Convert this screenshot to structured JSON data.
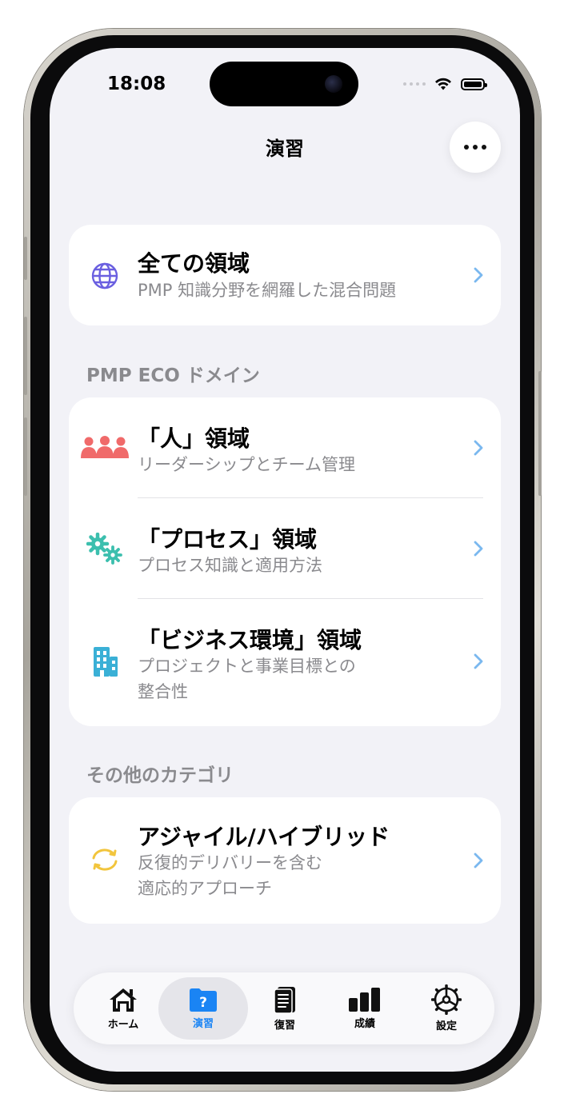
{
  "status_bar": {
    "time": "18:08"
  },
  "nav": {
    "title": "演習",
    "more_icon": "ellipsis-icon"
  },
  "all_domains": {
    "icon": "globe-icon",
    "title": "全ての領域",
    "subtitle": "PMP 知識分野を網羅した混合問題"
  },
  "sections": [
    {
      "header": "PMP ECO ドメイン",
      "items": [
        {
          "icon": "people-icon",
          "title": "「人」領域",
          "subtitle": "リーダーシップとチーム管理"
        },
        {
          "icon": "gears-icon",
          "title": "「プロセス」領域",
          "subtitle": "プロセス知識と適用方法"
        },
        {
          "icon": "building-icon",
          "title": "「ビジネス環境」領域",
          "subtitle_line1": "プロジェクトと事業目標との",
          "subtitle_line2": "整合性"
        }
      ]
    },
    {
      "header": "その他のカテゴリ",
      "items": [
        {
          "icon": "cycle-arrows-icon",
          "title": "アジャイル/ハイブリッド",
          "subtitle_line1": "反復的デリバリーを含む",
          "subtitle_line2": "適応的アプローチ"
        }
      ]
    }
  ],
  "tabbar": {
    "active": "演習",
    "tabs": [
      {
        "label": "ホーム",
        "icon": "home-icon"
      },
      {
        "label": "演習",
        "icon": "question-folder-icon"
      },
      {
        "label": "復習",
        "icon": "notebook-icon"
      },
      {
        "label": "成績",
        "icon": "bar-chart-icon"
      },
      {
        "label": "設定",
        "icon": "gear-icon"
      }
    ]
  },
  "colors": {
    "accent": "#1a84f4",
    "people": "#f06a6a",
    "gears": "#3cbfae",
    "building": "#3ab0d6",
    "cycle": "#f2c53d",
    "globe": "#6a5fe0",
    "chevron": "#7ab8ef"
  }
}
